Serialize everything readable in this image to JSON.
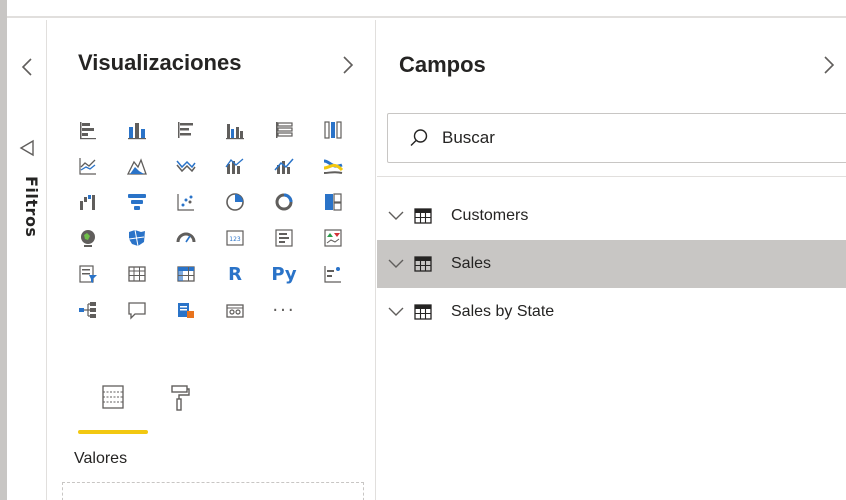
{
  "filters": {
    "label": "Filtros"
  },
  "visualizations": {
    "title": "Visualizaciones",
    "icons": [
      "stacked-bar-icon",
      "stacked-column-icon",
      "clustered-bar-icon",
      "clustered-column-icon",
      "100-stacked-bar-icon",
      "100-stacked-column-icon",
      "line-chart-icon",
      "area-chart-icon",
      "stacked-area-icon",
      "line-stacked-column-icon",
      "line-clustered-column-icon",
      "ribbon-chart-icon",
      "waterfall-chart-icon",
      "funnel-chart-icon",
      "scatter-chart-icon",
      "pie-chart-icon",
      "donut-chart-icon",
      "treemap-icon",
      "map-icon",
      "filled-map-icon",
      "gauge-icon",
      "card-icon",
      "multi-row-card-icon",
      "kpi-icon",
      "slicer-icon",
      "table-icon",
      "matrix-icon",
      "r-script-icon",
      "python-visual-icon",
      "key-influencers-icon",
      "decomposition-tree-icon",
      "qa-icon",
      "smart-narrative-icon",
      "paginated-report-icon",
      "more-visuals-icon"
    ],
    "r_label": "R",
    "py_label": "Py",
    "more_label": "···",
    "card_label": "123",
    "values_label": "Valores",
    "accent": "#f2c811"
  },
  "fields": {
    "title": "Campos",
    "search_placeholder": "Buscar",
    "tables": [
      {
        "name": "Customers",
        "selected": false
      },
      {
        "name": "Sales",
        "selected": true
      },
      {
        "name": "Sales by State",
        "selected": false
      }
    ]
  }
}
